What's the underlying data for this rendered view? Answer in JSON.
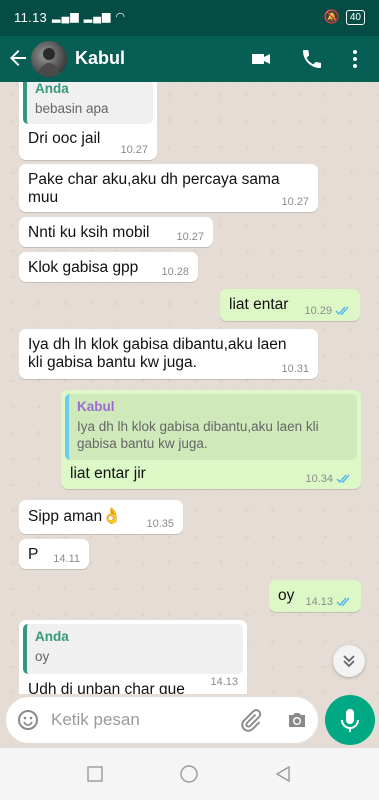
{
  "status_bar": {
    "time": "11.13",
    "battery": "40"
  },
  "header": {
    "contact_name": "Kabul"
  },
  "messages": [
    {
      "kind": "incoming-reply",
      "quote_name": "Anda",
      "quote_text": "bebasin apa",
      "text": "Dri ooc jail",
      "time": "10.27"
    },
    {
      "kind": "incoming",
      "line1": "Pake char aku,aku dh percaya sama",
      "line2": "muu",
      "time": "10.27"
    },
    {
      "kind": "incoming",
      "text": "Nnti ku ksih mobil",
      "time": "10.27"
    },
    {
      "kind": "incoming",
      "text": "Klok gabisa gpp",
      "time": "10.28"
    },
    {
      "kind": "outgoing",
      "text": "liat entar",
      "time": "10.29"
    },
    {
      "kind": "incoming",
      "line1": "Iya dh lh klok gabisa dibantu,aku laen",
      "line2": "kli gabisa bantu kw juga.",
      "time": "10.31"
    },
    {
      "kind": "outgoing-reply",
      "quote_name": "Kabul",
      "quote_line1": "Iya dh lh klok gabisa dibantu,aku laen kli",
      "quote_line2": "gabisa bantu kw juga.",
      "text": "liat entar jir",
      "time": "10.34"
    },
    {
      "kind": "incoming",
      "text": "Sipp aman",
      "emoji": "👌",
      "time": "10.35"
    },
    {
      "kind": "incoming",
      "text": "P",
      "time": "14.11"
    },
    {
      "kind": "outgoing",
      "text": "oy",
      "time": "14.13"
    },
    {
      "kind": "incoming-reply",
      "quote_name": "Anda",
      "quote_text": "oy",
      "text": "Udh di unban char gue",
      "time": "14.13"
    }
  ],
  "composer": {
    "placeholder": "Ketik pesan"
  },
  "colors": {
    "header": "#075e54",
    "status_bar": "#054d44",
    "outgoing": "#dcf8c6",
    "incoming": "#ffffff",
    "accent": "#00a884",
    "read_ticks": "#4fb6ec"
  },
  "icons": [
    "back-arrow-icon",
    "video-call-icon",
    "phone-icon",
    "more-vert-icon",
    "emoji-icon",
    "attach-icon",
    "camera-icon",
    "mic-icon",
    "scroll-down-icon",
    "nav-recents-icon",
    "nav-home-icon",
    "nav-back-icon"
  ]
}
